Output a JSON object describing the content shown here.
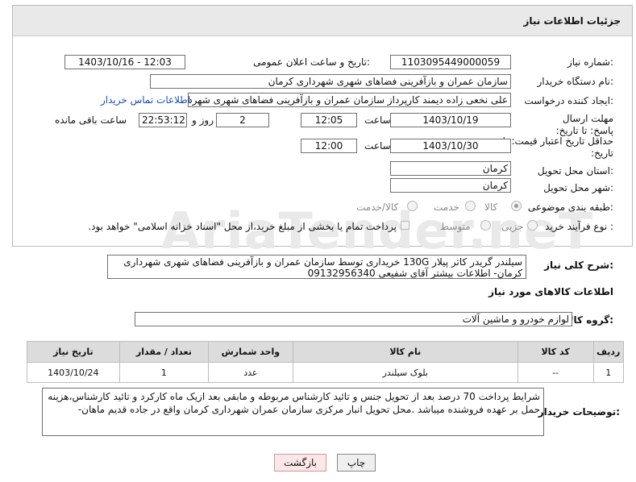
{
  "header": {
    "title": "جزئیات اطلاعات نیاز"
  },
  "form": {
    "need_number": {
      "label": "شماره نیاز:",
      "value": "1103095449000059"
    },
    "announce": {
      "label": "تاریخ و ساعت اعلان عمومی:",
      "value": "1403/10/16 - 12:03"
    },
    "buyer_org": {
      "label": "نام دستگاه خریدار:",
      "value": "سازمان عمران و بازآفرینی فضاهای شهری شهرداری کرمان"
    },
    "creator": {
      "label": "ایجاد کننده درخواست:",
      "value": "علی نخعی زاده دیمند کارپرداز سازمان عمران و بازآفرینی فضاهای شهری شهردا",
      "contact_link": "اطلاعات تماس خریدار"
    },
    "reply_deadline": {
      "label": "مهلت ارسال پاسخ: تا تاریخ:",
      "date": "1403/10/19",
      "time_label": "ساعت",
      "time": "12:05",
      "days": "2",
      "days_label": "روز و",
      "remaining": "22:53:12",
      "remaining_label": "ساعت باقی مانده"
    },
    "price_validity": {
      "label": "حداقل تاریخ اعتبار قیمت: تا تاریخ:",
      "date": "1403/10/30",
      "time_label": "ساعت",
      "time": "12:00"
    },
    "province": {
      "label": "استان محل تحویل:",
      "value": "کرمان"
    },
    "city": {
      "label": "شهر محل تحویل:",
      "value": "کرمان"
    },
    "category": {
      "label": "طبقه بندی موضوعی:",
      "options": [
        "کالا",
        "خدمت",
        "کالا/خدمت"
      ]
    },
    "purchase_type": {
      "label": "نوع فرآیند خرید :",
      "options": [
        "جزیی",
        "متوسط"
      ],
      "note": "پرداخت تمام یا بخشی از مبلغ خرید،از محل \"اسناد خزانه اسلامی\" خواهد بود."
    }
  },
  "summary": {
    "label": "شرح کلی نیاز:",
    "text": "سیلندر گریدر کاتر پیلار 130G خریداری توسط سازمان عمران و بازآفرینی فضاهای شهری شهرداری کرمان- اطلاعات بیشتر آقای شفیعی 09132956340"
  },
  "goods": {
    "section_title": "اطلاعات کالاهای مورد نیاز",
    "group_label": "گروه کالا:",
    "group_value": "لوازم خودرو و ماشین آلات",
    "columns": [
      "ردیف",
      "کد کالا",
      "نام کالا",
      "واحد شمارش",
      "تعداد / مقدار",
      "تاریخ نیاز"
    ],
    "rows": [
      {
        "row": "1",
        "code": "--",
        "name": "بلوک سیلندر",
        "unit": "عدد",
        "qty": "1",
        "date": "1403/10/24"
      }
    ]
  },
  "buyer_notes": {
    "label": "توضیحات خریدار:",
    "text": "شرایط پرداخت 70 درصد بعد از تحویل جنس و تائید کارشناس مربوطه و مابقی بعد ازیک ماه کارکرد و تائید کارشناس،هزینه حمل بر عهده فروشنده میباشد .محل تحویل انبار مرکزی سازمان عمران شهرداری کرمان واقع در جاده قدیم ماهان-"
  },
  "buttons": {
    "print": "چاپ",
    "back": "بازگشت"
  },
  "watermark": "AriaTender.neT"
}
